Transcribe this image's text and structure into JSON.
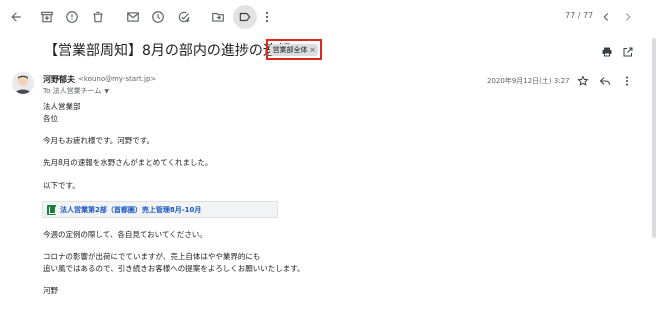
{
  "toolbar": {
    "icons": [
      "back-arrow-icon",
      "archive-icon",
      "report-spam-icon",
      "delete-icon",
      "mark-unread-icon",
      "snooze-icon",
      "add-to-tasks-icon",
      "move-to-icon",
      "label-icon",
      "more-vert-icon"
    ],
    "pager_text": "77 / 77"
  },
  "subject": {
    "title": "【営業部周知】8月の部内の進捗の速報",
    "label_chip": "営業部全体",
    "label_chip_close": "×",
    "highlight_color": "#e0251b"
  },
  "message": {
    "sender_name": "河野郁夫",
    "sender_email": "<kouno@my-start.jp>",
    "to_text": "To 法人営業チーム",
    "date": "2020年9月12日(土) 3:27"
  },
  "body": {
    "lines": [
      "法人営業部",
      "各位",
      "今月もお疲れ様です。河野です。",
      "先月8月の速報を水野さんがまとめてくれました。",
      "以下です。",
      "今週の定例の際して、各自見ておいてください。",
      "コロナの影響が出荷にでていますが、売上自体はやや業界的にも",
      "追い風ではあるので、引き続きお客様への提案をよろしくお願いいたします。",
      "河野"
    ]
  },
  "attachment": {
    "label": "法人営業第2部（首都圏）売上管理8月-10月",
    "icon": "google-sheets-icon",
    "color": "#1a56c4"
  }
}
